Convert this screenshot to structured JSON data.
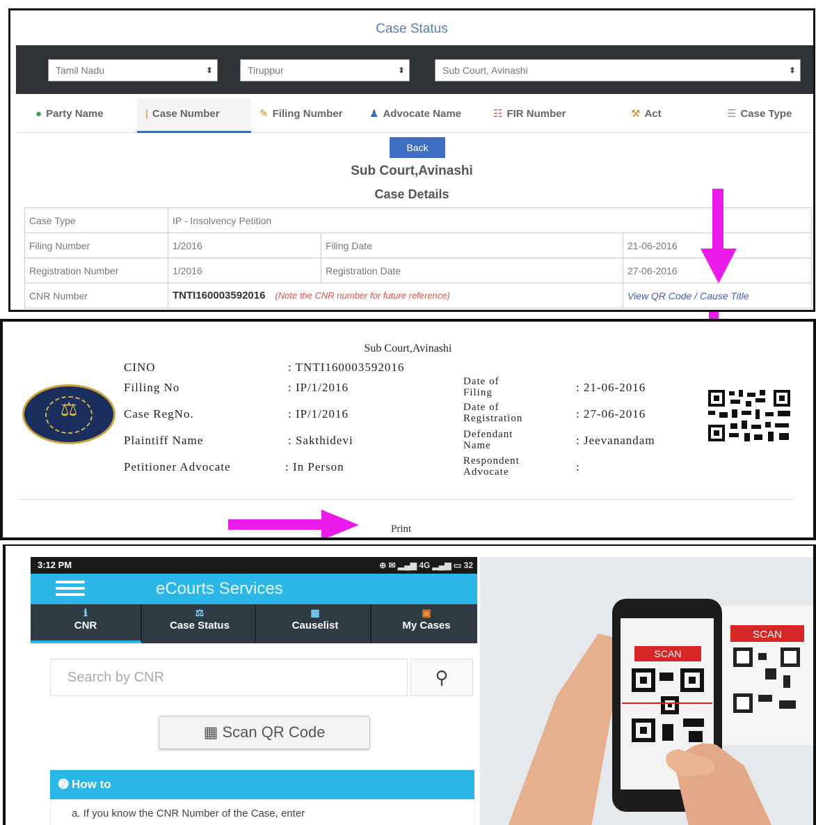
{
  "case_status_page": {
    "title": "Case Status",
    "selects": {
      "state": "Tamil Nadu",
      "district": "Tiruppur",
      "court": "Sub Court, Avinashi"
    },
    "tabs": [
      {
        "label": "Party Name",
        "icon": "party-icon"
      },
      {
        "label": "Case Number",
        "icon": "case-number-icon"
      },
      {
        "label": "Filing Number",
        "icon": "filing-icon"
      },
      {
        "label": "Advocate Name",
        "icon": "advocate-icon"
      },
      {
        "label": "FIR Number",
        "icon": "fir-icon"
      },
      {
        "label": "Act",
        "icon": "act-icon"
      },
      {
        "label": "Case Type",
        "icon": "case-type-icon"
      }
    ],
    "back_label": "Back",
    "court_name": "Sub Court,Avinashi",
    "section_title": "Case Details",
    "rows": {
      "case_type_label": "Case Type",
      "case_type_value": "IP - Insolvency Petition",
      "filing_number_label": "Filing Number",
      "filing_number_value": "1/2016",
      "filing_date_label": "Filing Date",
      "filing_date_value": "21-06-2016",
      "registration_number_label": "Registration Number",
      "registration_number_value": "1/2016",
      "registration_date_label": "Registration Date",
      "registration_date_value": "27-06-2016",
      "cnr_label": "CNR Number",
      "cnr_value": "TNTI160003592016",
      "cnr_note": "(Note the CNR number for future reference)",
      "view_qr": "View QR Code",
      "separator": " / ",
      "cause_title": "Cause Title"
    }
  },
  "print_sheet": {
    "court_name": "Sub Court,Avinashi",
    "cino_label": "CINO",
    "cino_value": ": TNTI160003592016",
    "filing_no_label": "Filling No",
    "filing_no_value": ": IP/1/2016",
    "case_reg_label": "Case RegNo.",
    "case_reg_value": ": IP/1/2016",
    "plaintiff_label": "Plaintiff Name",
    "plaintiff_value": ": Sakthidevi",
    "pet_adv_label": "Petitioner Advocate",
    "pet_adv_value": ": In Person",
    "date_filing_label_1": "Date of",
    "date_filing_label_2": "Filing",
    "date_filing_value": ": 21-06-2016",
    "date_reg_label_1": "Date of",
    "date_reg_label_2": "Registration",
    "date_reg_value": ": 27-06-2016",
    "defendant_label_1": "Defendant",
    "defendant_label_2": "Name",
    "defendant_value": ": Jeevanandam",
    "resp_adv_label_1": "Respondent",
    "resp_adv_label_2": "Advocate",
    "resp_adv_value": ":",
    "print_label": "Print"
  },
  "mobile_app": {
    "time": "3:12 PM",
    "status_icons": "4G",
    "battery": "32",
    "app_title": "eCourts Services",
    "nav": [
      {
        "label": "CNR",
        "icon": "info-icon"
      },
      {
        "label": "Case Status",
        "icon": "scales-icon"
      },
      {
        "label": "Causelist",
        "icon": "calendar-icon"
      },
      {
        "label": "My Cases",
        "icon": "folder-icon"
      }
    ],
    "search_placeholder": "Search by CNR",
    "scan_label": "Scan QR Code",
    "howto_label": "How to",
    "instruction": "a. If you know the CNR Number of the Case, enter"
  },
  "photo": {
    "scan_banner": "SCAN",
    "screen_banner": "SCAN"
  },
  "colors": {
    "arrow": "#e81be8",
    "app_blue": "#2bb6e8",
    "nav_dark": "#2e3b43",
    "select_bar": "#2f3236",
    "back_button": "#3f6fc4"
  }
}
